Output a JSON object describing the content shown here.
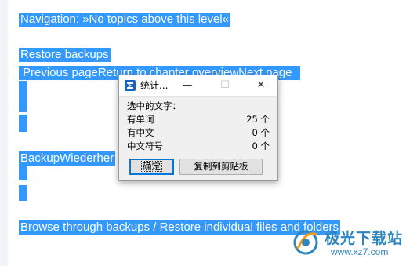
{
  "document": {
    "nav_line": "Navigation:  »No topics above this level«",
    "heading": "Restore backups",
    "links_line": "Previous pageReturn to chapter overviewNext page",
    "partial_word": "BackupWiederher",
    "browse_line": "Browse through backups / Restore individual files and folders"
  },
  "dialog": {
    "title": "统计...",
    "minimize": "—",
    "maximize": "☐",
    "close": "✕",
    "selected_label": "选中的文字：",
    "rows": [
      {
        "label": "有单词",
        "value": "25 个"
      },
      {
        "label": "有中文",
        "value": "0 个"
      },
      {
        "label": "中文符号",
        "value": "0 个"
      }
    ],
    "ok_label": "确定",
    "copy_label": "复制到剪贴板"
  },
  "watermark": {
    "name": "极光下载站",
    "url": "www.xz7.com"
  },
  "colors": {
    "selection": "#3399ff",
    "dialog_bg": "#f0f0f0",
    "watermark": "#2e86c1"
  }
}
